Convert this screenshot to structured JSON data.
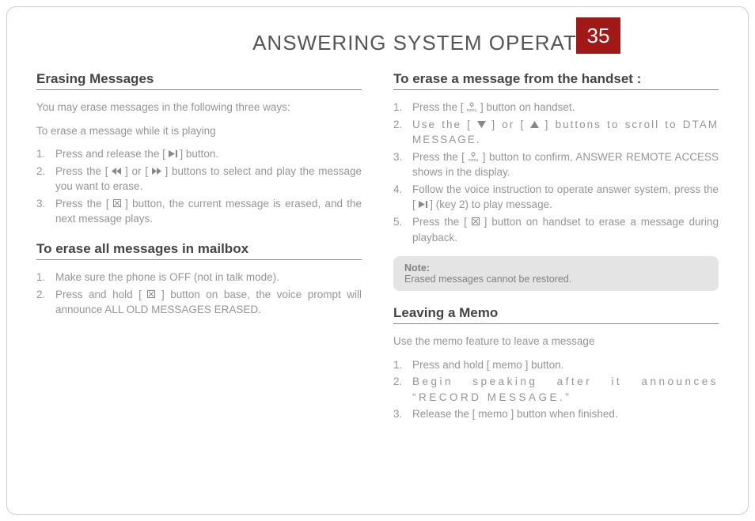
{
  "page": {
    "title": "ANSWERING SYSTEM OPERATION",
    "number": "35"
  },
  "left": {
    "h1": "Erasing Messages",
    "intro1": "You may erase messages in the following three ways:",
    "intro2": "To erase a message while it is playing",
    "list1": {
      "i1a": "Press and release the [ ",
      "i1b": " ] button.",
      "i2a": "Press the [ ",
      "i2b": " ] or [ ",
      "i2c": " ] buttons to select and play the message you want to erase.",
      "i3a": "Press the [ ",
      "i3b": " ] button, the current message is erased, and the next message plays."
    },
    "h2": "To erase all messages in mailbox",
    "list2": {
      "i1": "Make sure the phone is OFF (not in talk mode).",
      "i2a": "Press and hold [ ",
      "i2b": " ] button on base, the voice prompt will announce ALL OLD MESSAGES ERASED."
    }
  },
  "right": {
    "h1": "To erase a message from the handset :",
    "list1": {
      "i1a": "Press the [ ",
      "i1b": " ] button on handset.",
      "i2a": "Use the [ ",
      "i2b": " ] or [ ",
      "i2c": " ] buttons to scroll to DTAM MESSAGE.",
      "i3a": "Press the [ ",
      "i3b": " ] button to confirm, ANSWER REMOTE ACCESS shows in the display.",
      "i4a": "Follow the voice instruction to operate answer system, press the [ ",
      "i4b": " ] (key 2) to play message.",
      "i5a": "Press the [ ",
      "i5b": " ] button on handset to erase a message during playback."
    },
    "note_label": "Note:",
    "note_text": "Erased messages cannot be restored.",
    "h2": "Leaving a Memo",
    "intro2": "Use the memo feature to leave a message",
    "list2": {
      "i1": "Press and hold [ memo ] button.",
      "i2": "Begin speaking after it announces “RECORD MESSAGE.”",
      "i3": "Release the [ memo ] button when finished."
    }
  }
}
